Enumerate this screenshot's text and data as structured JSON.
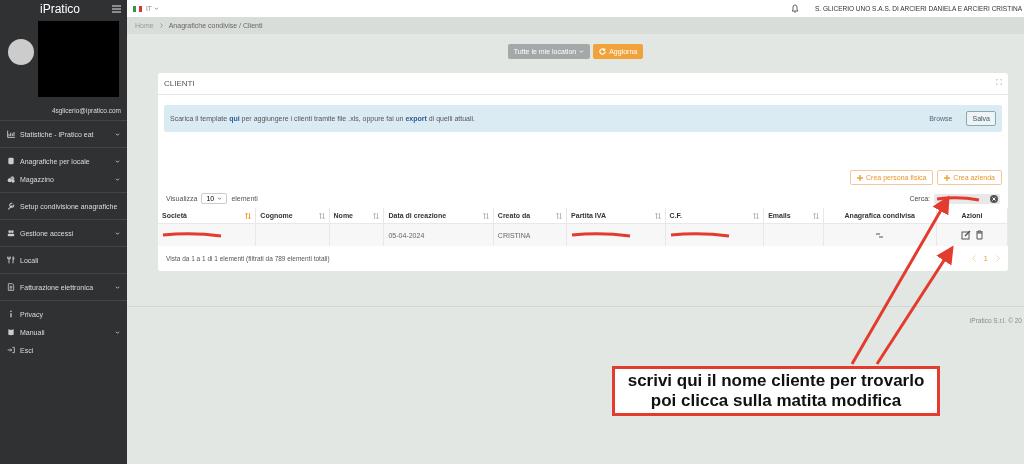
{
  "sidebar": {
    "logo": "iPratico",
    "email": "4sglicerio@ipratico.com",
    "groups": [
      [
        {
          "label": "Statistiche - iPratico eat",
          "has_submenu": true
        }
      ],
      [
        {
          "label": "Anagrafiche per locale",
          "has_submenu": true
        },
        {
          "label": "Magazzino",
          "has_submenu": true
        }
      ],
      [
        {
          "label": "Setup condivisione anagrafiche",
          "has_submenu": false
        }
      ],
      [
        {
          "label": "Gestione accessi",
          "has_submenu": true
        }
      ],
      [
        {
          "label": "Locali",
          "has_submenu": false
        }
      ],
      [
        {
          "label": "Fatturazione elettronica",
          "has_submenu": true
        }
      ],
      [
        {
          "label": "Privacy",
          "has_submenu": false
        },
        {
          "label": "Manuali",
          "has_submenu": true
        },
        {
          "label": "Esci",
          "has_submenu": false
        }
      ]
    ]
  },
  "topbar": {
    "language": "IT",
    "company": "S. GLICERIO UNO S.A.S. DI ARCIERI DANIELA E ARCIERI CRISTINA"
  },
  "breadcrumb": [
    "Home",
    "Anagrafiche condivise / Clienti"
  ],
  "toolbar": {
    "location_button": "Tutte le mie location",
    "refresh_button": "Aggiorna"
  },
  "panel": {
    "title": "CLIENTI",
    "notice": "Scarica il template **qui** per aggiungere i clienti tramite file .xls, oppure fai un **export** di quelli attuali.",
    "browse": "Browse",
    "save": "Salva",
    "create_buttons": [
      "Crea persona fisica",
      "Crea azienda"
    ],
    "show_label": "Visualizza",
    "page_size": "10",
    "show_suffix": "elementi",
    "search_label": "Cerca:",
    "columns": [
      {
        "label": "Società",
        "sortable": true,
        "sorted": true
      },
      {
        "label": "Cognome",
        "sortable": true,
        "sorted": false
      },
      {
        "label": "Nome",
        "sortable": true,
        "sorted": false
      },
      {
        "label": "Data di creazione",
        "sortable": true,
        "sorted": false
      },
      {
        "label": "Creato da",
        "sortable": true,
        "sorted": false
      },
      {
        "label": "Partita IVA",
        "sortable": true,
        "sorted": false
      },
      {
        "label": "C.F.",
        "sortable": true,
        "sorted": false
      },
      {
        "label": "Emails",
        "sortable": true,
        "sorted": false
      },
      {
        "label": "Anagrafica condivisa",
        "sortable": false
      },
      {
        "label": "Azioni",
        "sortable": false
      }
    ],
    "rows": [
      [
        {
          "kind": "redacted"
        },
        {
          "kind": "empty"
        },
        {
          "kind": "empty"
        },
        {
          "kind": "text",
          "text": "05-04-2024"
        },
        {
          "kind": "text",
          "text": "CRISTINA"
        },
        {
          "kind": "redacted"
        },
        {
          "kind": "redacted"
        },
        {
          "kind": "empty"
        },
        {
          "kind": "shared"
        },
        {
          "kind": "actions"
        }
      ]
    ],
    "info": "Vista da 1 a 1 di 1 elementi (filtrati da 789 elementi totali)",
    "pages": [
      {
        "label": "1",
        "selected": true
      }
    ]
  },
  "footer": "iPratico S.r.l. © 20",
  "annotation": {
    "text": "scrivi qui il nome cliente per trovarlo poi clicca sulla matita modifica"
  }
}
